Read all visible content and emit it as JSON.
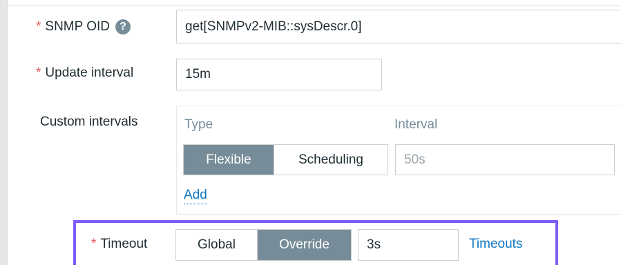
{
  "snmp_oid": {
    "required_mark": "*",
    "label": "SNMP OID",
    "help_glyph": "?",
    "value": "get[SNMPv2-MIB::sysDescr.0]"
  },
  "update_interval": {
    "required_mark": "*",
    "label": "Update interval",
    "value": "15m"
  },
  "custom_intervals": {
    "label": "Custom intervals",
    "columns": [
      "Type",
      "Interval"
    ],
    "type_options": [
      "Flexible",
      "Scheduling"
    ],
    "selected_type": "Flexible",
    "interval_placeholder": "50s",
    "add_label": "Add"
  },
  "timeout": {
    "required_mark": "*",
    "label": "Timeout",
    "options": [
      "Global",
      "Override"
    ],
    "selected": "Override",
    "value": "3s",
    "link_label": "Timeouts"
  },
  "colors": {
    "accent_highlight": "#7c5cf5",
    "segment_active": "#768d99",
    "link": "#0f77c4",
    "required": "#e45959"
  }
}
